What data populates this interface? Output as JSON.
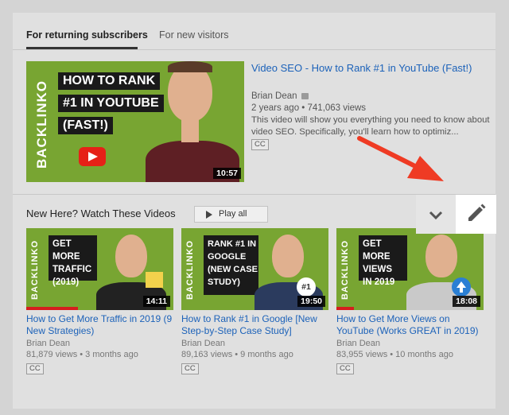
{
  "tabs": [
    {
      "label": "For returning subscribers",
      "active": true
    },
    {
      "label": "For new visitors",
      "active": false
    }
  ],
  "featured": {
    "title": "Video SEO - How to Rank #1 in YouTube (Fast!)",
    "channel": "Brian Dean",
    "stats": "2 years ago • 741,063 views",
    "description": "This video will show you everything you need to know about video SEO. Specifically, you'll learn how to optimiz...",
    "cc": "CC",
    "duration": "10:57",
    "thumb_brand": "BACKLINKO",
    "thumb_text": [
      "HOW TO RANK",
      "#1 IN YOUTUBE",
      "(FAST!)"
    ]
  },
  "section": {
    "title": "New Here? Watch These Videos",
    "play_all": "Play all"
  },
  "videos": [
    {
      "title": "How to Get More Traffic in 2019 (9 New Strategies)",
      "channel": "Brian Dean",
      "stats": "81,879 views • 3 months ago",
      "cc": "CC",
      "duration": "14:11",
      "thumb_text": [
        "GET MORE",
        "TRAFFIC",
        "(2019)"
      ],
      "progress": 0.35
    },
    {
      "title": "How to Rank #1 in Google [New Step-by-Step Case Study]",
      "channel": "Brian Dean",
      "stats": "89,163 views • 9 months ago",
      "cc": "CC",
      "duration": "19:50",
      "thumb_text": [
        "RANK #1 IN",
        "GOOGLE",
        "(NEW CASE",
        "STUDY)"
      ],
      "badge": "#1",
      "progress": 0.0
    },
    {
      "title": "How to Get More Views on YouTube (Works GREAT in 2019)",
      "channel": "Brian Dean",
      "stats": "83,955 views • 10 months ago",
      "cc": "CC",
      "duration": "18:08",
      "thumb_text": [
        "GET MORE",
        "VIEWS",
        "IN 2019"
      ],
      "progress": 0.12
    }
  ],
  "colors": {
    "link": "#1c62b9",
    "thumb_green": "#78a532",
    "annotation_arrow": "#ef3b24"
  },
  "icons": {
    "chevron": "chevron-down-icon",
    "edit": "pencil-icon",
    "play": "play-icon"
  }
}
